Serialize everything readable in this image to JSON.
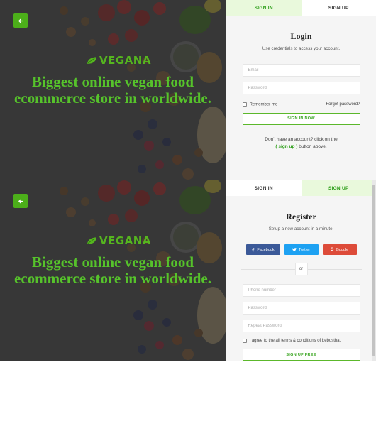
{
  "brand": {
    "name": "VEGANA",
    "accent": "#4caf1a"
  },
  "hero": {
    "tagline": "Biggest online vegan food ecommerce store in worldwide."
  },
  "login": {
    "tabs": [
      {
        "label": "SIGN IN",
        "active": true
      },
      {
        "label": "SIGN UP",
        "active": false
      }
    ],
    "title": "Login",
    "subtitle": "Use credentials to access your account.",
    "email_placeholder": "Email",
    "password_placeholder": "Password",
    "remember_label": "Remember me",
    "forgot_label": "Forgot password?",
    "submit_label": "SIGN IN NOW",
    "prompt_line1": "Don't have an account? click on the",
    "prompt_link": "( sign up )",
    "prompt_line2": " button above."
  },
  "register": {
    "tabs": [
      {
        "label": "SIGN IN",
        "active": false
      },
      {
        "label": "SIGN UP",
        "active": true
      }
    ],
    "title": "Register",
    "subtitle": "Setup a new account in a minute.",
    "social": [
      {
        "label": "Facebook",
        "icon": "facebook-icon",
        "color": "#3b5998"
      },
      {
        "label": "Twitter",
        "icon": "twitter-icon",
        "color": "#1da1f2"
      },
      {
        "label": "Google",
        "icon": "google-icon",
        "color": "#dd4b39"
      }
    ],
    "or_label": "or",
    "phone_placeholder": "Phone number",
    "password_placeholder": "Password",
    "repeat_placeholder": "Repeat Password",
    "terms_label": "I agree to the all terms & conditions of bebostha.",
    "submit_label": "SIGN UP FREE"
  }
}
